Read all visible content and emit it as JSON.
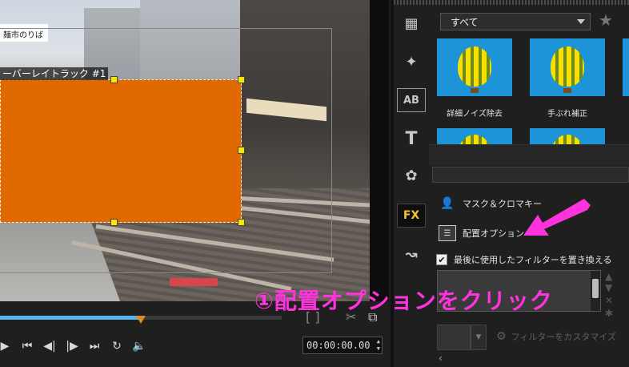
{
  "preview": {
    "track_label": "ーバーレイトラック #1",
    "shop_sign": "麺市のりば",
    "overlay_color": "#e06a00"
  },
  "playback": {
    "progress_percent": 50,
    "timecode": "00:00:00.00",
    "buttons": [
      "play-icon",
      "go-start-icon",
      "prev-frame-icon",
      "next-frame-icon",
      "go-end-icon",
      "repeat-icon",
      "volume-icon"
    ]
  },
  "library": {
    "category_select": "すべて",
    "thumbnails": [
      {
        "label": "詳細ノイズ除去"
      },
      {
        "label": "手ぶれ補正"
      }
    ]
  },
  "options": {
    "mask_chroma": "マスク＆クロマキー",
    "placement": "配置オプション",
    "replace_filter": "最後に使用したフィルターを置き換える",
    "replace_checked": true,
    "customize_filter": "フィルターをカスタマイズ"
  },
  "annotation": {
    "text": "①配置オプションをクリック",
    "color": "#ff33dd"
  }
}
